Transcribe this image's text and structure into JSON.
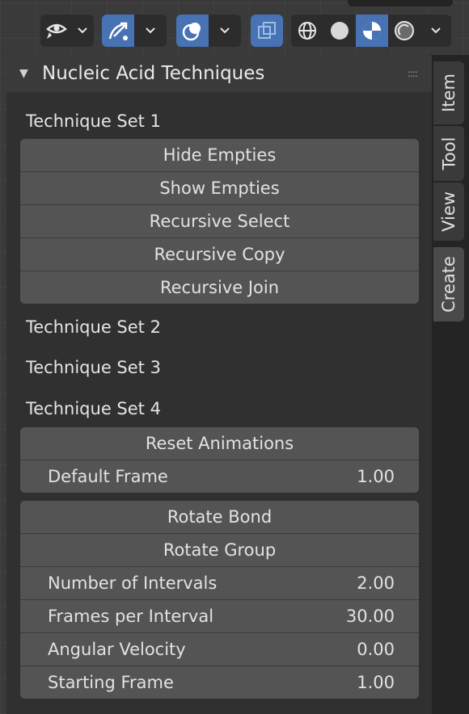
{
  "header": {
    "icons": [
      "visibility-icon",
      "gizmo-icon",
      "overlay-icon",
      "xray-icon",
      "wireframe-shading-icon",
      "solid-shading-icon",
      "material-shading-icon",
      "rendered-shading-icon"
    ],
    "accent": "#4772b3"
  },
  "panel": {
    "title": "Nucleic Acid Techniques",
    "sets": [
      {
        "label": "Technique Set 1"
      },
      {
        "label": "Technique Set 2"
      },
      {
        "label": "Technique Set 3"
      },
      {
        "label": "Technique Set 4"
      }
    ],
    "set1_buttons": [
      "Hide Empties",
      "Show Empties",
      "Recursive Select",
      "Recursive Copy",
      "Recursive Join"
    ],
    "anim": {
      "reset_label": "Reset Animations",
      "default_frame_label": "Default Frame",
      "default_frame_value": "1.00"
    },
    "rotate": {
      "bond_label": "Rotate Bond",
      "group_label": "Rotate Group",
      "fields": [
        {
          "label": "Number of Intervals",
          "value": "2.00"
        },
        {
          "label": "Frames per Interval",
          "value": "30.00"
        },
        {
          "label": "Angular Velocity",
          "value": "0.00"
        },
        {
          "label": "Starting Frame",
          "value": "1.00"
        }
      ]
    }
  },
  "tabs": [
    "Item",
    "Tool",
    "View",
    "Create"
  ]
}
